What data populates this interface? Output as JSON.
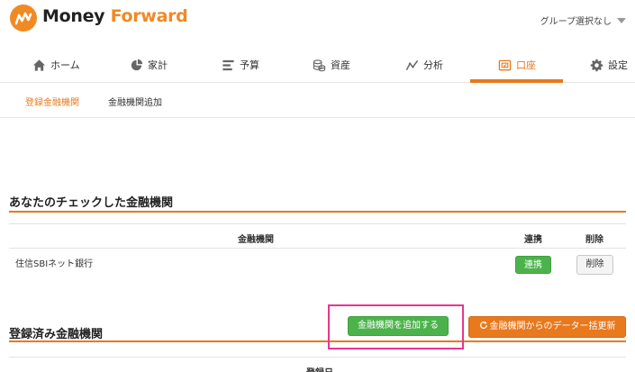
{
  "header": {
    "brand_part1": "Money ",
    "brand_part2": "Forward",
    "group_select": "グループ選択なし",
    "colors": {
      "brand": "#e8791d",
      "logo": "#f08a24"
    }
  },
  "nav": {
    "items": [
      {
        "label": "ホーム",
        "icon": "home-icon"
      },
      {
        "label": "家計",
        "icon": "pie-chart-icon"
      },
      {
        "label": "予算",
        "icon": "budget-icon"
      },
      {
        "label": "資産",
        "icon": "coins-icon"
      },
      {
        "label": "分析",
        "icon": "line-chart-icon"
      },
      {
        "label": "口座",
        "icon": "account-icon",
        "active": true
      },
      {
        "label": "設定",
        "icon": "gear-icon"
      }
    ]
  },
  "subnav": {
    "items": [
      {
        "label": "登録金融機関",
        "active": true
      },
      {
        "label": "金融機関追加",
        "active": false
      }
    ]
  },
  "checked_section": {
    "title": "あなたのチェックした金融機関",
    "columns": [
      "金融機関",
      "連携",
      "削除"
    ],
    "rows": [
      {
        "name": "住信SBIネット銀行",
        "link_button": "連携",
        "delete_button": "削除"
      }
    ]
  },
  "registered_section": {
    "title": "登録済み金融機関",
    "add_button": "金融機関を追加する",
    "refresh_button": "金融機関からのデーター括更新",
    "columns": [
      "登録日"
    ]
  },
  "colors": {
    "green": "#4cb34c",
    "orange": "#e8791d",
    "highlight": "#e8368f"
  }
}
